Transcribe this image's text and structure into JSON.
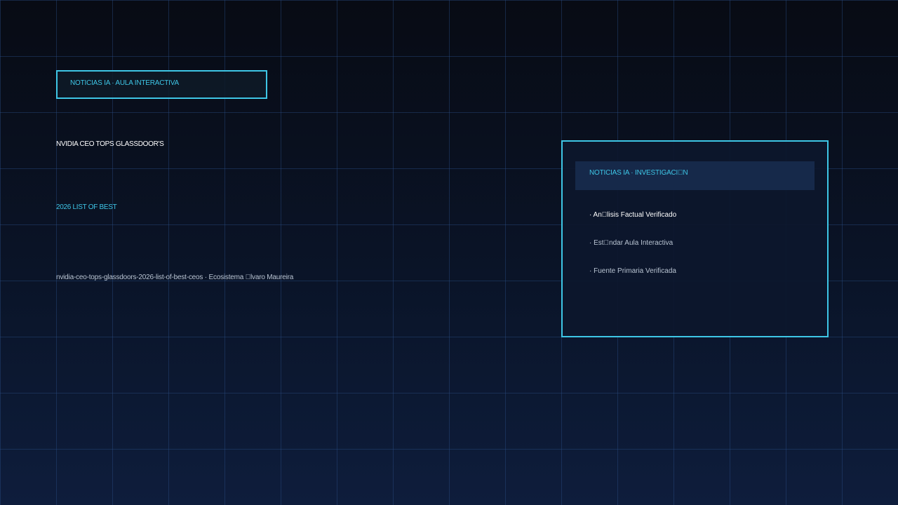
{
  "tag": {
    "label": "NOTICIAS IA · AULA INTERACTIVA"
  },
  "article": {
    "title_line1": "NVIDIA CEO TOPS GLASSDOOR'S",
    "title_line2": "2026 LIST OF BEST",
    "slug": "nvidia-ceo-tops-glassdoors-2026-list-of-best-ceos · Ecosistema \u0000lvaro Maureira"
  },
  "panel": {
    "header": "NOTICIAS IA · INVESTIGACI\u0000N",
    "items": [
      "· An\u0000lisis Factual Verificado",
      "· Est\u0000ndar Aula Interactiva",
      "· Fuente Primaria Verificada"
    ]
  },
  "colors": {
    "accent": "#3ec6e6",
    "background_top": "#080b14",
    "background_bottom": "#0e1d3c",
    "panel_header": "#16294a",
    "text_primary": "#ffffff",
    "text_secondary": "#b9c4d2"
  }
}
